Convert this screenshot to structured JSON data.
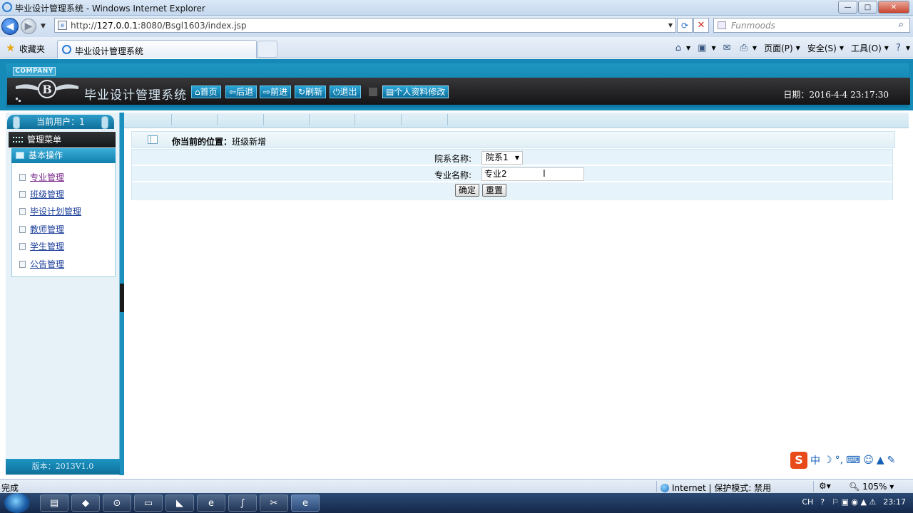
{
  "window": {
    "title": "毕业设计管理系统 - Windows Internet Explorer",
    "controls": {
      "minimize": "—",
      "maximize": "□",
      "close": "✕"
    }
  },
  "navbar": {
    "url_prefix": "http://",
    "url_host": "127.0.0.1",
    "url_path": ":8080/Bsgl1603/index.jsp",
    "search_placeholder": "Funmoods"
  },
  "favbar": {
    "favorites_label": "收藏夹",
    "tab_title": "毕业设计管理系统",
    "commands": [
      {
        "icon": "home-icon",
        "label": ""
      },
      {
        "icon": "rss-icon",
        "label": ""
      },
      {
        "icon": "mail-icon",
        "label": ""
      },
      {
        "icon": "print-icon",
        "label": ""
      },
      {
        "icon": "page-icon",
        "label": "页面(P)"
      },
      {
        "icon": "safety-icon",
        "label": "安全(S)"
      },
      {
        "icon": "tools-icon",
        "label": "工具(O)"
      },
      {
        "icon": "help-icon",
        "label": ""
      }
    ]
  },
  "header": {
    "company": "COMPANY",
    "system_title": "毕业设计管理系统",
    "buttons": [
      "首页",
      "后退",
      "前进",
      "刷新",
      "退出"
    ],
    "profile_button": "个人资料修改",
    "date": "日期：2016-4-4 23:17:30"
  },
  "sidebar": {
    "current_user": "当前用户：1",
    "menu_title": "管理菜单",
    "section_title": "基本操作",
    "items": [
      "专业管理",
      "班级管理",
      "毕设计划管理",
      "教师管理",
      "学生管理",
      "公告管理"
    ],
    "version": "版本：2013V1.0"
  },
  "main": {
    "location_label": "你当前的位置：",
    "location_value": "班级新增",
    "fields": {
      "department_label": "院系名称:",
      "department_value": "院系1",
      "major_label": "专业名称:",
      "major_value": "专业2"
    },
    "buttons": {
      "confirm": "确定",
      "reset": "重置"
    }
  },
  "status": {
    "text": "完成",
    "zone": "Internet | 保护模式: 禁用",
    "zoom": "105%"
  },
  "taskbar": {
    "clock": "23:17",
    "lang": "CH"
  }
}
